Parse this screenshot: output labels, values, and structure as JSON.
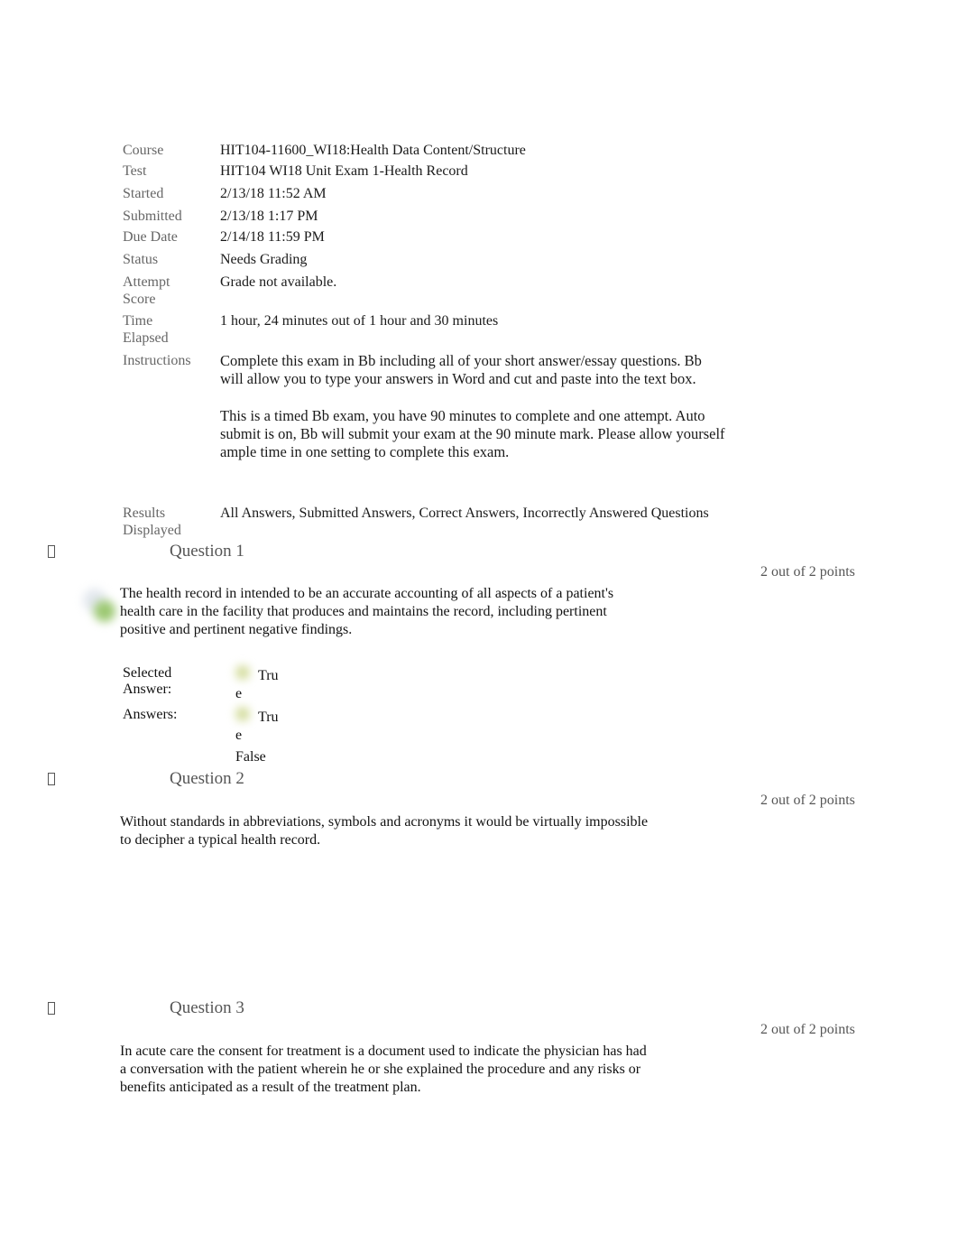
{
  "attempt_info": {
    "course": {
      "label": "Course",
      "value": "HIT104-11600_WI18:Health Data Content/Structure"
    },
    "test": {
      "label": "Test",
      "value": "HIT104 WI18 Unit Exam 1-Health Record"
    },
    "started": {
      "label": "Started",
      "value": "2/13/18 11:52 AM"
    },
    "submitted": {
      "label": "Submitted",
      "value": "2/13/18 1:17 PM"
    },
    "due_date": {
      "label": "Due Date",
      "value": "2/14/18 11:59 PM"
    },
    "status": {
      "label": "Status",
      "value": "Needs Grading"
    },
    "attempt_score": {
      "label_line1": "Attempt",
      "label_line2": "Score",
      "value": "Grade not available."
    },
    "time_elapsed": {
      "label_line1": "Time",
      "label_line2": "Elapsed",
      "value": "1 hour, 24 minutes out of 1 hour and 30 minutes"
    },
    "instructions": {
      "label": "Instructions",
      "paragraph1": "Complete this exam in Bb including all of your short answer/essay questions. Bb will allow you to type your answers in Word and cut and paste into the text box.",
      "paragraph2": "This is a timed Bb exam, you have 90 minutes to complete and one attempt. Auto submit is on, Bb will submit your exam at the 90 minute mark. Please allow yourself ample time in one setting to complete this exam."
    },
    "results_displayed": {
      "label_line1": "Results",
      "label_line2": "Displayed",
      "value": "All Answers, Submitted Answers, Correct Answers, Incorrectly Answered Questions"
    }
  },
  "questions": [
    {
      "title": "Question 1",
      "points": "2 out of 2 points",
      "text": "The health record in intended to be an accurate accounting of all aspects of a patient's health care in the facility that produces and maintains the record, including pertinent positive and pertinent negative findings.",
      "selected_answer_label_line1": "Selected",
      "selected_answer_label_line2": "Answer:",
      "selected_answer_part1": "Tru",
      "selected_answer_part2": "e",
      "answers_label": "Answers:",
      "answer1_part1": "Tru",
      "answer1_part2": "e",
      "answer2": "False",
      "status_icon": "correct-checkmark-icon"
    },
    {
      "title": "Question 2",
      "points": "2 out of 2 points",
      "text": "Without standards in abbreviations, symbols and acronyms it would be virtually impossible to decipher a typical health record."
    },
    {
      "title": "Question 3",
      "points": "2 out of 2 points",
      "text": "In acute care the consent for treatment is a document used to indicate the physician has had a conversation with the patient wherein he or she explained the procedure and any risks or benefits anticipated as a result of the treatment plan."
    }
  ],
  "colors": {
    "label_gray": "#666666",
    "correct_green": "#8dc063",
    "answer_highlight": "#c9d98a"
  }
}
